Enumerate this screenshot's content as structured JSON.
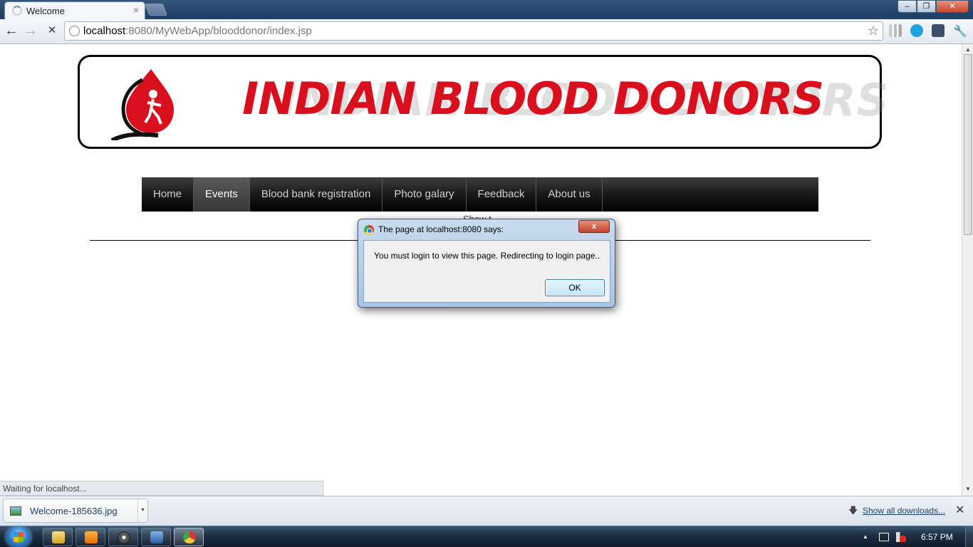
{
  "browser": {
    "tab_title": "Welcome",
    "tab_close": "×",
    "url_host": "localhost",
    "url_rest": ":8080/MyWebApp/blooddonor/index.jsp",
    "back_glyph": "←",
    "forward_glyph": "→",
    "stop_glyph": "✕",
    "star_glyph": "☆",
    "window_minimize": "–",
    "window_maximize": "❐",
    "window_close": "✕"
  },
  "page": {
    "site_title": "INDIAN BLOOD DONORS",
    "nav": [
      {
        "label": "Home",
        "active": false
      },
      {
        "label": "Events",
        "active": true
      },
      {
        "label": "Blood bank registration",
        "active": false
      },
      {
        "label": "Photo galary",
        "active": false
      },
      {
        "label": "Feedback",
        "active": false
      },
      {
        "label": "About us",
        "active": false
      }
    ],
    "partial_text": "Show t",
    "colors": {
      "title_red": "#d90f1e",
      "nav_bg": "#000000"
    }
  },
  "dialog": {
    "title": "The page at localhost:8080 says:",
    "message": "You must login to view this page. Redirecting to login page..",
    "ok_label": "OK",
    "close_glyph": "x"
  },
  "status": {
    "text": "Waiting for localhost..."
  },
  "downloads": {
    "file_name": "Welcome-185636.jpg",
    "show_all_label": "Show all downloads...",
    "dropdown_glyph": "▾",
    "arrow_glyph": "🡇",
    "close_glyph": "✕"
  },
  "taskbar": {
    "clock": "6:57 PM",
    "tray_up_glyph": "▲"
  }
}
